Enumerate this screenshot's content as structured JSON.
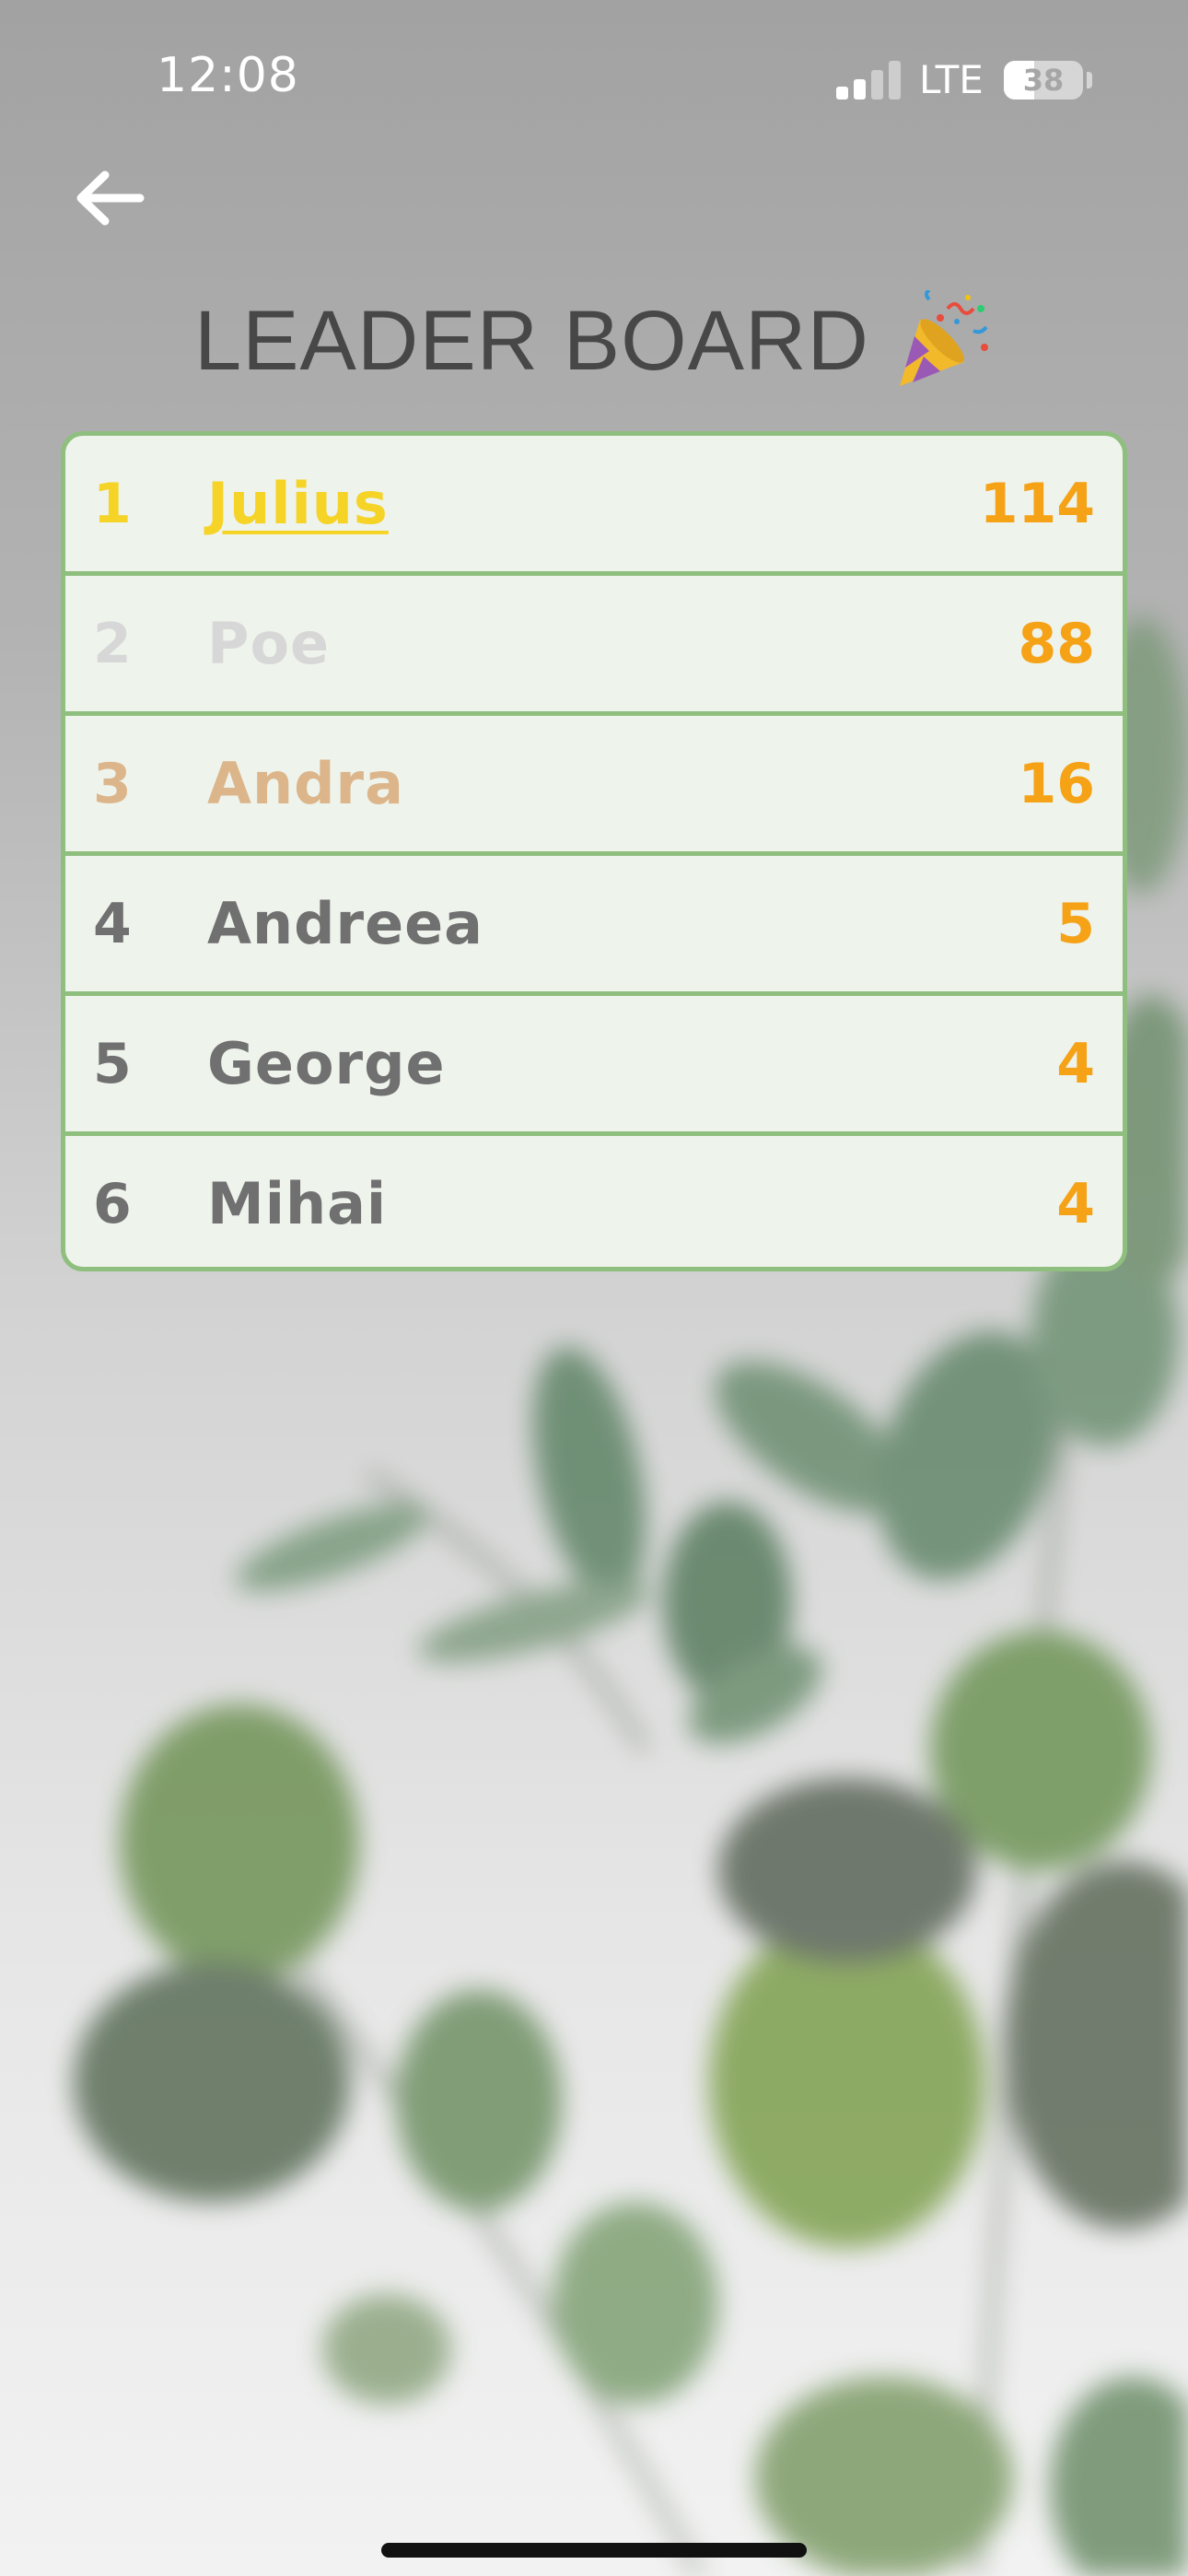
{
  "status": {
    "time": "12:08",
    "network": "LTE",
    "battery": "38",
    "battery_level": 0.38,
    "signal_bars_active": 2
  },
  "header": {
    "title": "LEADER BOARD",
    "title_icon": "party-popper-icon",
    "back_icon": "back-arrow-icon"
  },
  "leaderboard": {
    "rows": [
      {
        "rank": "1",
        "name": "Julius",
        "score": "114",
        "color": "#f5d327",
        "underline": true
      },
      {
        "rank": "2",
        "name": "Poe",
        "score": "88",
        "color": "#d7d7d7",
        "underline": false
      },
      {
        "rank": "3",
        "name": "Andra",
        "score": "16",
        "color": "#dcb68a",
        "underline": false
      },
      {
        "rank": "4",
        "name": "Andreea",
        "score": "5",
        "color": "#707070",
        "underline": false
      },
      {
        "rank": "5",
        "name": "George",
        "score": "4",
        "color": "#707070",
        "underline": false
      },
      {
        "rank": "6",
        "name": "Mihai",
        "score": "4",
        "color": "#707070",
        "underline": false
      }
    ],
    "score_color": "#f5a217",
    "border_color": "#8fbf7e",
    "row_background": "#eef3ec"
  }
}
